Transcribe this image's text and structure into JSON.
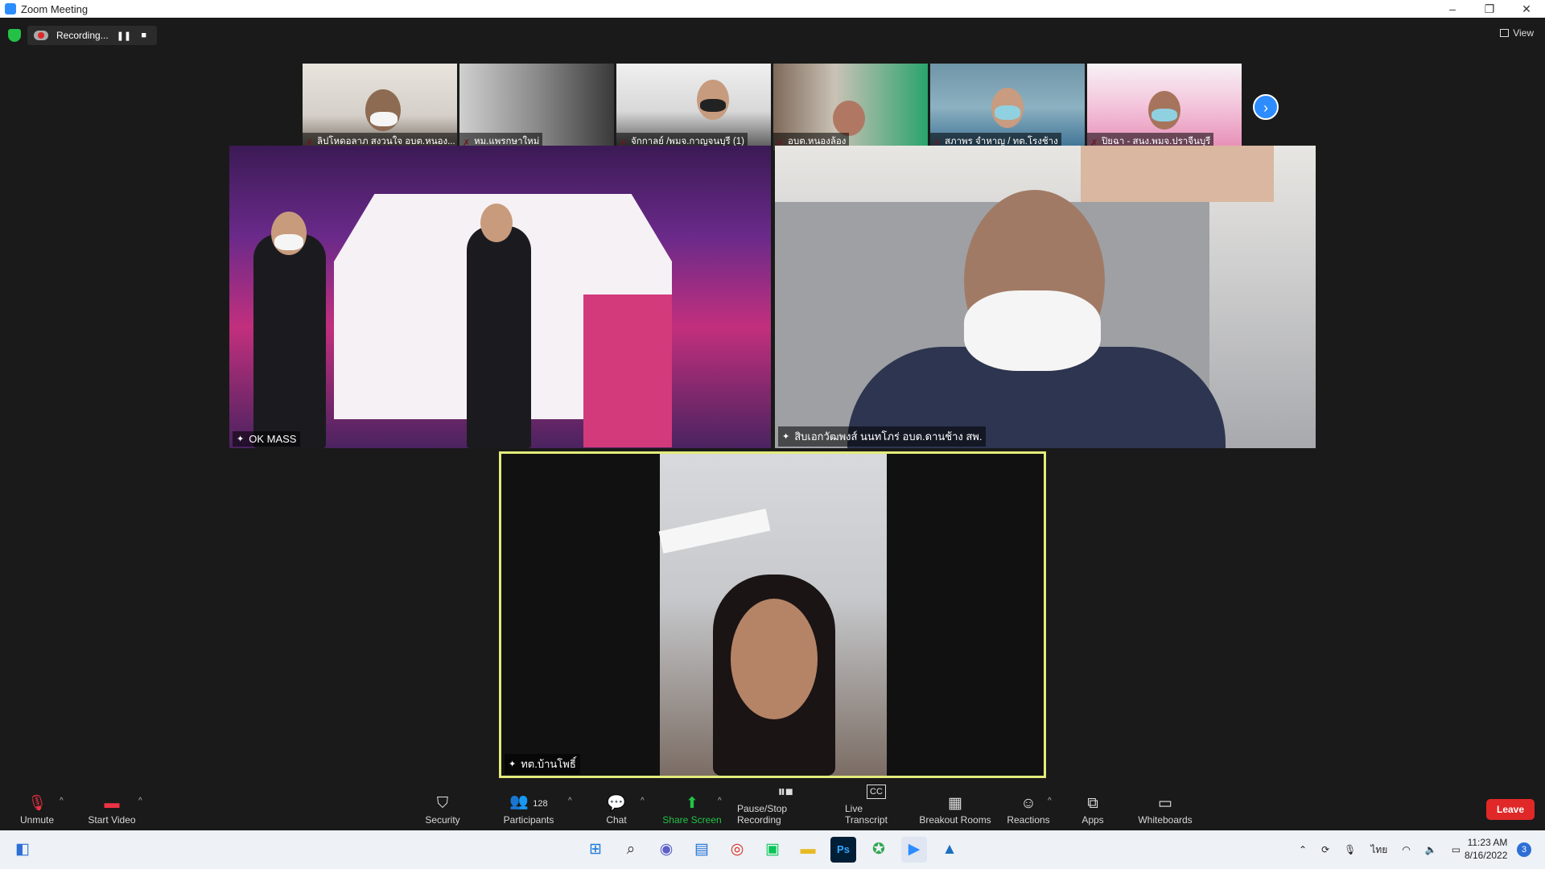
{
  "window": {
    "title": "Zoom Meeting",
    "controls": [
      "–",
      "❐",
      "✕"
    ]
  },
  "recording": {
    "status": "Recording...",
    "pause": "❚❚",
    "stop": "■"
  },
  "view": {
    "label": "View"
  },
  "thumbnails": [
    {
      "name": "ลิปโหดอลาภ สงวนใจ อบต.หนอง..."
    },
    {
      "name": "หม.แพรกษาใหม่"
    },
    {
      "name": "จักกาลย์ /พมจ.กาญจนบุรี (1)"
    },
    {
      "name": "อบต.หนองล้อง"
    },
    {
      "name": "สภาพร จำหาญ / ทต.โรงช้าง"
    },
    {
      "name": "ปิยฉา - สนง.พมจ.ปราจีนบุรี"
    }
  ],
  "tiles": {
    "main_left": {
      "name": "OK MASS"
    },
    "main_right": {
      "name": "สิบเอกวัฒพงส์ นนทโภร่ อบต.ดานช้าง สพ."
    },
    "active_speaker": {
      "name": "ทต.บ้านโพธิ์"
    }
  },
  "toolbar": {
    "unmute": "Unmute",
    "start_video": "Start Video",
    "security": "Security",
    "participants": "Participants",
    "participants_count": "128",
    "chat": "Chat",
    "share_screen": "Share Screen",
    "pause_stop_recording": "Pause/Stop Recording",
    "live_transcript": "Live Transcript",
    "live_transcript_icon_text": "CC",
    "breakout_rooms": "Breakout Rooms",
    "reactions": "Reactions",
    "apps": "Apps",
    "whiteboards": "Whiteboards",
    "leave": "Leave"
  },
  "taskbar": {
    "language": "ไทย",
    "time": "11:23 AM",
    "date": "8/16/2022",
    "notifications": "3",
    "ps_label": "Ps"
  },
  "colors": {
    "accent": "#2d8cff",
    "leave": "#e02828",
    "share": "#23c246",
    "speaker_border": "#e3eb7a"
  }
}
